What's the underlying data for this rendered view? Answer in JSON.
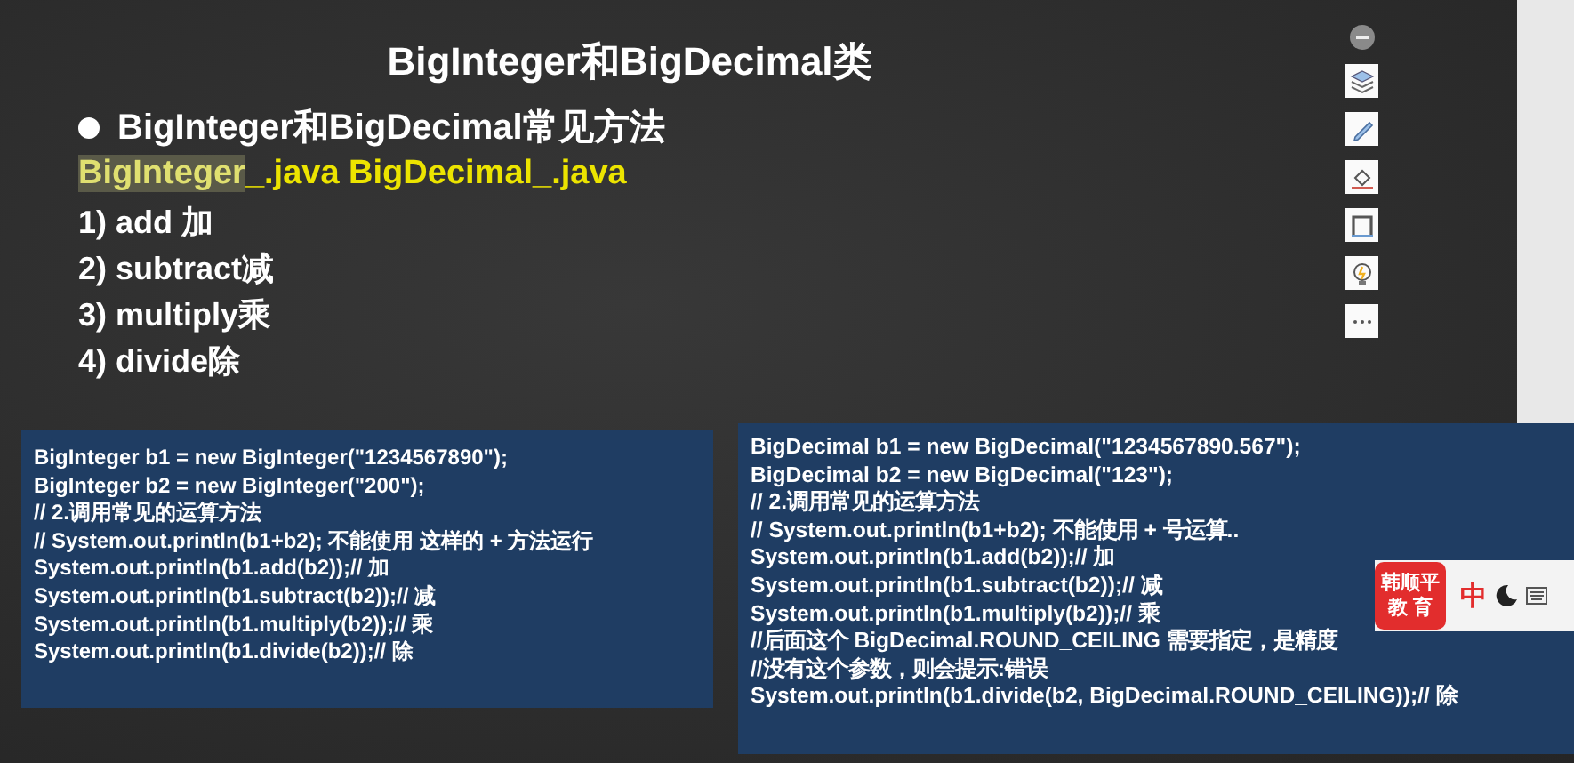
{
  "slide": {
    "title": "BigInteger和BigDecimal类",
    "heading": "BigInteger和BigDecimal常见方法",
    "files": [
      {
        "text": "BigInteger",
        "selected": true
      },
      {
        "text": "_.java BigDecimal_.java",
        "selected": false
      }
    ],
    "methods": [
      "1) add 加",
      "2) subtract减",
      "3) multiply乘",
      "4) divide除"
    ]
  },
  "code_blocks": [
    {
      "lines": [
        "BigInteger b1 = new BigInteger(\"1234567890\");",
        "BigInteger b2 = new BigInteger(\"200\");",
        "// 2.调用常见的运算方法",
        "// System.out.println(b1+b2); 不能使用 这样的 + 方法运行",
        "System.out.println(b1.add(b2));// 加",
        "System.out.println(b1.subtract(b2));// 减",
        "System.out.println(b1.multiply(b2));// 乘",
        "System.out.println(b1.divide(b2));// 除"
      ]
    },
    {
      "lines": [
        "BigDecimal b1 = new BigDecimal(\"1234567890.567\");",
        "BigDecimal b2 = new BigDecimal(\"123\");",
        "// 2.调用常见的运算方法",
        "// System.out.println(b1+b2); 不能使用 + 号运算..",
        "System.out.println(b1.add(b2));// 加",
        "System.out.println(b1.subtract(b2));// 减",
        "System.out.println(b1.multiply(b2));// 乘",
        "//后面这个 BigDecimal.ROUND_CEILING 需要指定，是精度",
        "//没有这个参数，则会提示:错误",
        "System.out.println(b1.divide(b2, BigDecimal.ROUND_CEILING));// 除"
      ]
    }
  ],
  "ime": {
    "logo_lines": [
      "韩顺平",
      "教 育"
    ],
    "mode": "中"
  }
}
